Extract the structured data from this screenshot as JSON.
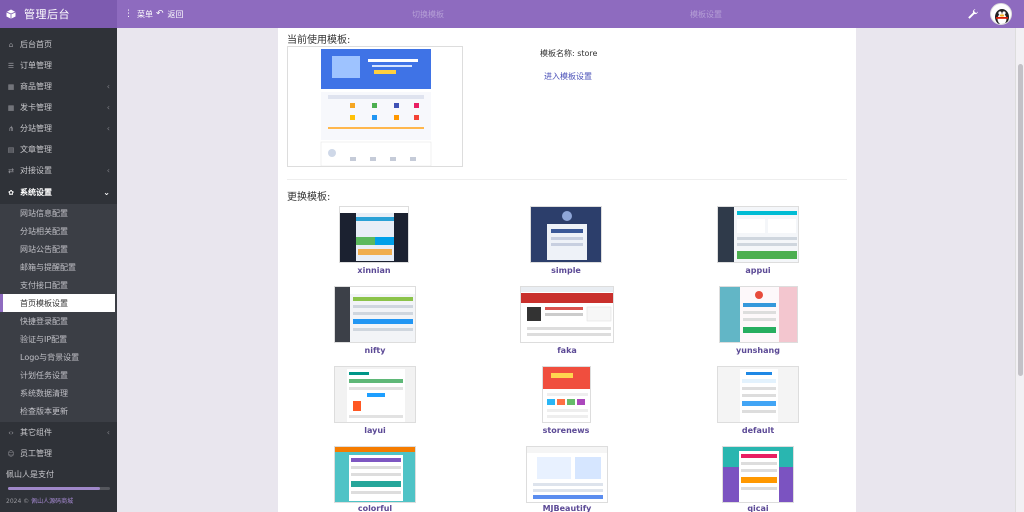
{
  "app": {
    "title": "管理后台",
    "menu_label": "菜单",
    "back_label": "返回",
    "faded_tab_1": "切换模板",
    "faded_tab_2": "模板设置"
  },
  "sidebar": {
    "items": [
      {
        "label": "后台首页",
        "icon": "home-icon",
        "has_arrow": false
      },
      {
        "label": "订单管理",
        "icon": "list-icon",
        "has_arrow": false
      },
      {
        "label": "商品管理",
        "icon": "grid-icon",
        "has_arrow": true
      },
      {
        "label": "发卡管理",
        "icon": "grid-icon",
        "has_arrow": true
      },
      {
        "label": "分站管理",
        "icon": "sitemap-icon",
        "has_arrow": true
      },
      {
        "label": "文章管理",
        "icon": "doc-icon",
        "has_arrow": false
      },
      {
        "label": "对接设置",
        "icon": "link-icon",
        "has_arrow": true
      },
      {
        "label": "系统设置",
        "icon": "gear-icon",
        "has_arrow": true,
        "active": true
      }
    ],
    "submenu": [
      "网站信息配置",
      "分站相关配置",
      "网站公告配置",
      "邮箱与提醒配置",
      "支付接口配置",
      "首页模板设置",
      "快捷登录配置",
      "验证与IP配置",
      "Logo与背景设置",
      "计划任务设置",
      "系统数据清理",
      "检查版本更新"
    ],
    "current_submenu": "首页模板设置",
    "bottom_items": [
      {
        "label": "其它组件",
        "icon": "code-icon",
        "has_arrow": true
      },
      {
        "label": "员工管理",
        "icon": "user-icon",
        "has_arrow": false
      },
      {
        "label": "佩山人是支付",
        "icon": "",
        "has_arrow": false
      }
    ],
    "progress": 0.9,
    "footer_prefix": "2024 © ",
    "footer_link": "佩山人源码商城"
  },
  "main": {
    "current_heading": "当前使用模板:",
    "template_name_label": "模板名称: store",
    "enter_settings_link": "进入模板设置",
    "switch_heading": "更换模板:",
    "templates": [
      "xinnian",
      "simple",
      "appui",
      "nifty",
      "faka",
      "yunshang",
      "layui",
      "storenews",
      "default",
      "colorful",
      "MJBeautify",
      "qicai"
    ]
  },
  "colors": {
    "topbar": "#8e6bbf",
    "sidebar": "#2f3238",
    "accent": "#8e6bbf",
    "link": "#4a50b8",
    "template_name": "#5c4a96"
  }
}
